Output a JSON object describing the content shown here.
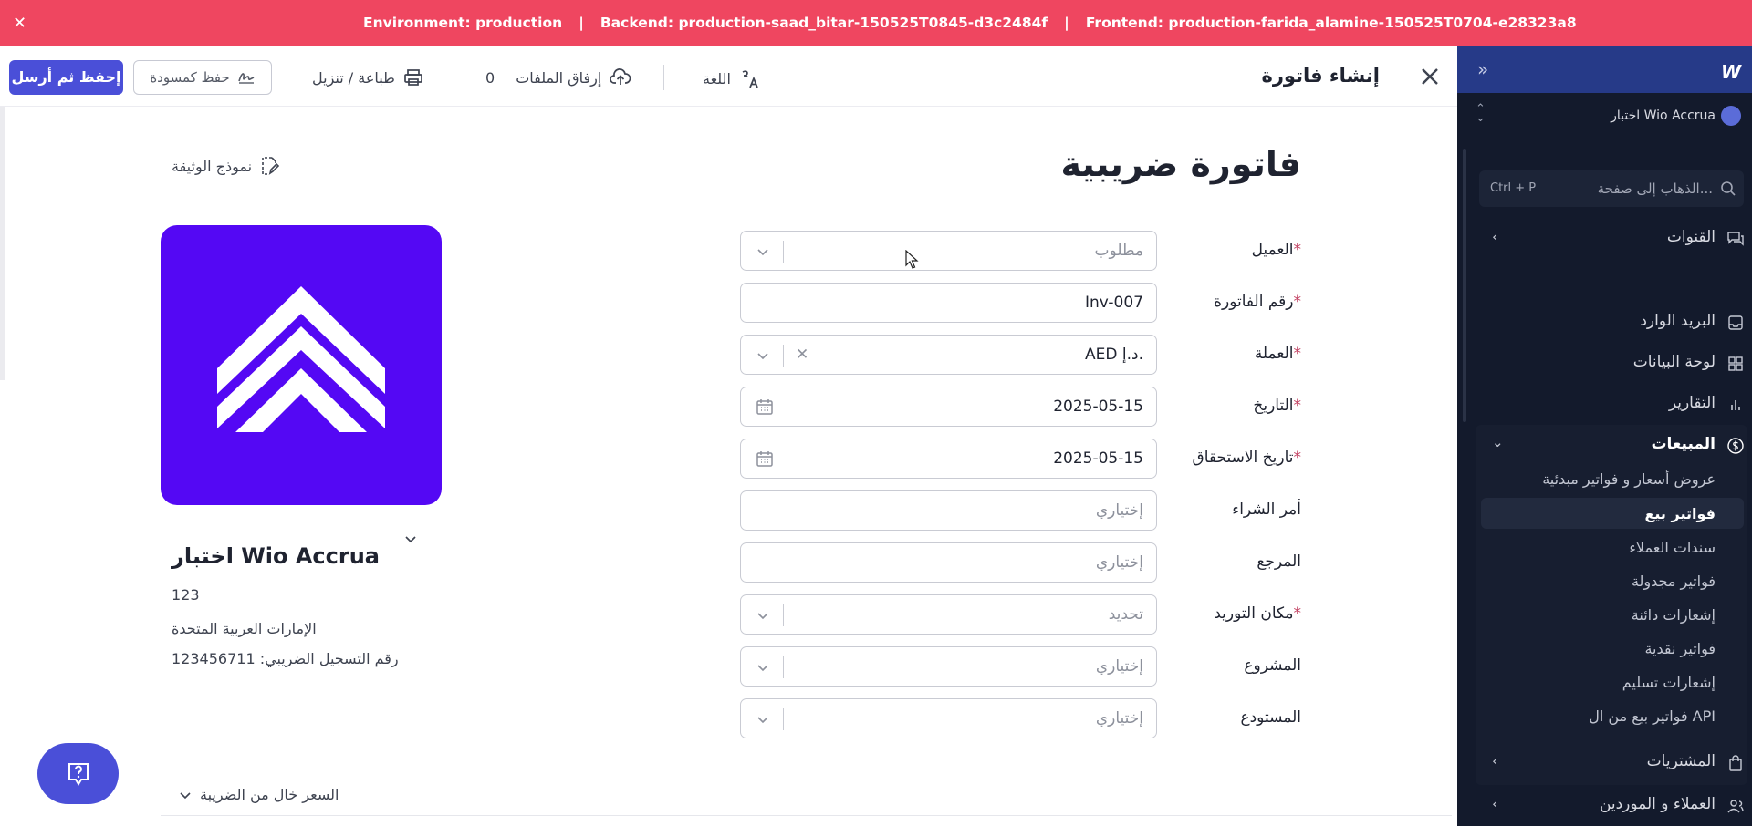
{
  "env_bar": {
    "environment": "Environment: production",
    "backend": "Backend: production-saad_bitar-150525T0845-d3c2484f",
    "frontend": "Frontend: production-farida_alamine-150525T0704-e28323a8",
    "separator": "|"
  },
  "toolbar": {
    "title": "إنشاء فاتورة",
    "language_label": "اللغة",
    "attach_label": "إرفاق الملفات",
    "attach_count": "0",
    "print_label": "طباعة / تنزيل",
    "save_draft_label": "حفظ كمسودة",
    "save_send_label": "إحفظ ثم أرسل"
  },
  "document": {
    "title": "فاتورة ضريبية",
    "template_label": "نموذج الوثيقة"
  },
  "company": {
    "name": "اختبار Wio Accrua",
    "line1": "123",
    "line2": "الإمارات العربية المتحدة",
    "tax_id": "رقم التسجيل الضريبي: 123456711"
  },
  "fields": {
    "customer": {
      "label": "العميل",
      "placeholder": "مطلوب"
    },
    "invoice_number": {
      "label": "رقم الفاتورة",
      "value": "Inv-007"
    },
    "currency": {
      "label": "العملة",
      "value": "AED د.إ."
    },
    "date": {
      "label": "التاريخ",
      "value": "2025-05-15"
    },
    "due_date": {
      "label": "تاريخ الاستحقاق",
      "value": "2025-05-15"
    },
    "purchase_order": {
      "label": "أمر الشراء",
      "placeholder": "إختياري"
    },
    "reference": {
      "label": "المرجع",
      "placeholder": "إختياري"
    },
    "place_of_supply": {
      "label": "مكان التوريد",
      "placeholder": "تحديد"
    },
    "project": {
      "label": "المشروع",
      "placeholder": "إختياري"
    },
    "warehouse": {
      "label": "المستودع",
      "placeholder": "إختياري"
    }
  },
  "required_mark": "*",
  "tax_toggle_label": "السعر خال من الضريبة",
  "sidebar": {
    "workspace": "اختبار Wio Accrua",
    "search_placeholder": "الذهاب إلى صفحة...",
    "search_shortcut": "Ctrl + P",
    "channels": "القنوات",
    "inbox": "البريد الوارد",
    "dashboard": "لوحة البيانات",
    "reports": "التقارير",
    "sales": "المبيعات",
    "sales_items": [
      "عروض أسعار و فواتير مبدئية",
      "فواتير بيع",
      "سندات العملاء",
      "فواتير مجدولة",
      "إشعارات دائنة",
      "فواتير نقدية",
      "إشعارات تسليم",
      "فواتير بيع من ال API"
    ],
    "purchases": "المشتريات",
    "customers_suppliers": "العملاء و الموردين"
  },
  "colors": {
    "env_bar": "#ef4660",
    "primary": "#4a4fd8",
    "logo_bg": "#5408f4",
    "sidebar_bg": "#131a2c",
    "sidebar_top": "#263a88"
  },
  "icons": [
    "close-icon",
    "language-icon",
    "upload-icon",
    "printer-icon",
    "signature-icon",
    "edit-document-icon",
    "chevron-down-icon",
    "calendar-icon",
    "help-icon",
    "search-icon",
    "expand-icon"
  ]
}
